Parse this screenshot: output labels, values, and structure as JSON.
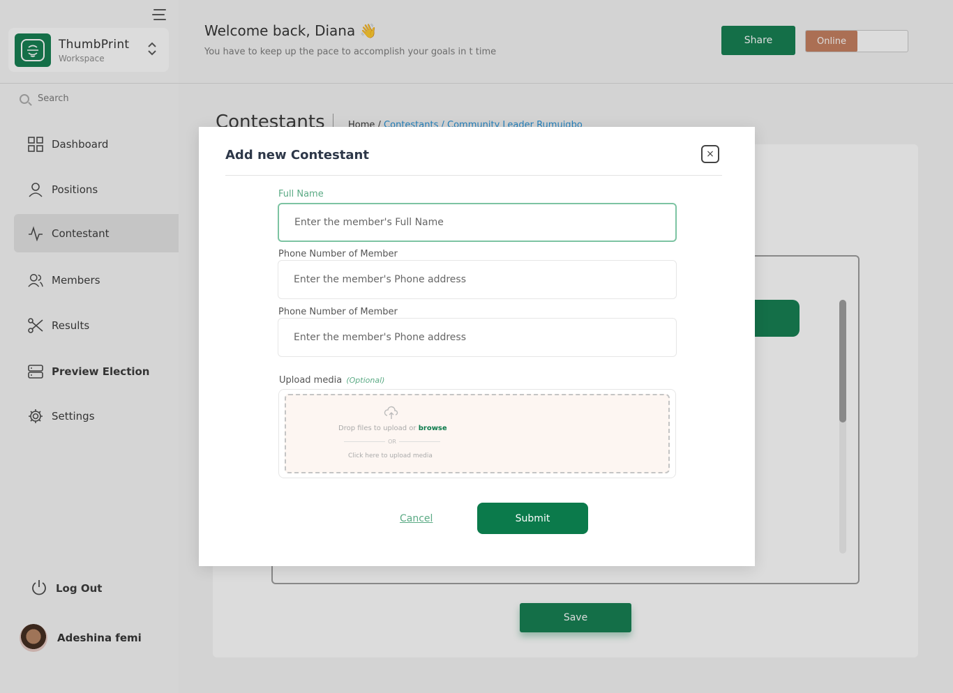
{
  "sidebar": {
    "workspace": {
      "name": "ThumbPrint",
      "subtitle": "Workspace"
    },
    "search_placeholder": "Search",
    "nav": [
      {
        "label": "Dashboard",
        "icon": "grid-icon"
      },
      {
        "label": "Positions",
        "icon": "user-icon"
      },
      {
        "label": "Contestant",
        "icon": "activity-icon",
        "active": true
      },
      {
        "label": "Members",
        "icon": "users-icon"
      },
      {
        "label": "Results",
        "icon": "scissors-icon"
      },
      {
        "label": "Preview Election",
        "icon": "server-icon"
      },
      {
        "label": "Settings",
        "icon": "gear-icon"
      }
    ],
    "logout_label": "Log Out",
    "user_name": "Adeshina femi"
  },
  "header": {
    "welcome": "Welcome back, Diana 👋",
    "subtext": "You have to keep up the pace to accomplish your goals in t time",
    "share_label": "Share",
    "status_label": "Online"
  },
  "page": {
    "title": "Contestants",
    "breadcrumb": {
      "home": "Home /",
      "contestants": "Contestants",
      "sep": "/",
      "current": "Community Leader Rumuigbo"
    },
    "save_label": "Save"
  },
  "modal": {
    "title": "Add new Contestant",
    "close_symbol": "×",
    "fields": [
      {
        "label": "Full Name",
        "placeholder": "Enter the member's Full Name"
      },
      {
        "label": "Phone Number of Member",
        "placeholder": "Enter the member's Phone address"
      },
      {
        "label": "Phone Number of Member",
        "placeholder": "Enter the member's Phone address"
      }
    ],
    "upload": {
      "label": "Upload media",
      "optional": "(Optional)",
      "drop_text": "Drop files to upload or",
      "browse": "browse",
      "or": "OR",
      "click_text": "Click here to upload media"
    },
    "cancel_label": "Cancel",
    "submit_label": "Submit"
  },
  "colors": {
    "primary_green": "#0b7a4b",
    "online_badge": "#c47a5a",
    "link_blue": "#1c8dd6",
    "label_green": "#5aaa84"
  }
}
